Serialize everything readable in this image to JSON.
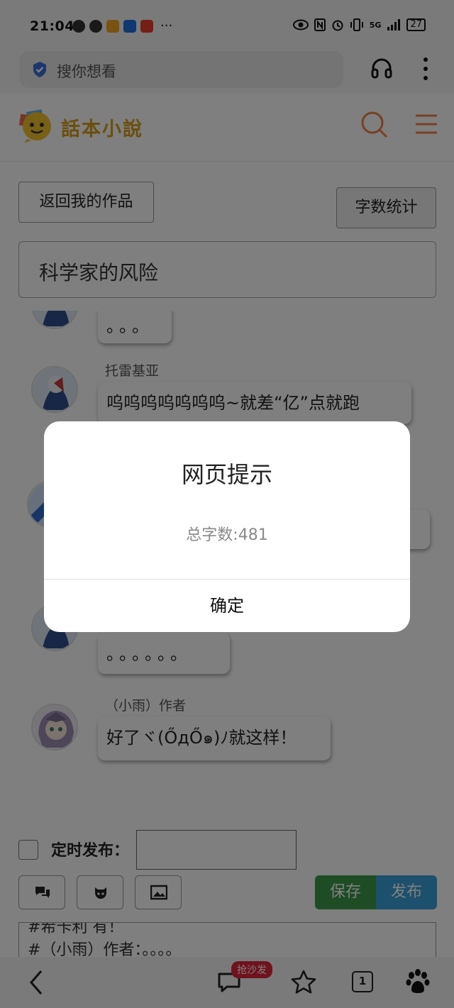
{
  "status_bar": {
    "time": "21:04",
    "network": "5G",
    "battery": "27",
    "more_indicator": "···"
  },
  "browser": {
    "search_placeholder": "搜你想看",
    "icons": [
      "shield-check-icon",
      "headset-icon",
      "kebab-menu-icon"
    ]
  },
  "site": {
    "logo_text": "話本小說",
    "icons": [
      "search-icon",
      "hamburger-menu-icon"
    ]
  },
  "editor_page": {
    "back_button": "返回我的作品",
    "word_count_button": "字数统计",
    "work_title": "科学家的风险",
    "messages": [
      {
        "sender": "",
        "text": "。。。",
        "avatar": "tolleo-avatar"
      },
      {
        "sender": "托雷基亚",
        "text": "呜呜呜呜呜呜呜~就差“亿”点就跑",
        "avatar": "tolleo-avatar"
      },
      {
        "sender": "",
        "text": "",
        "avatar": "blue-avatar"
      },
      {
        "sender": "",
        "text": "。。。。。。",
        "avatar": "tolleo-avatar"
      },
      {
        "sender": "（小雨）作者",
        "text": "好了ヾ(ŐдŐ๑)ﾉ就这样！",
        "avatar": "girl-avatar"
      }
    ],
    "schedule_label": "定时发布：",
    "schedule_value": "",
    "tool_icons": [
      "chat-bubbles-icon",
      "github-icon",
      "image-icon"
    ],
    "save_button": "保存",
    "publish_button": "发布",
    "editor_lines": [
      "#希卡利 有！",
      "#（小雨）作者：。。。。"
    ]
  },
  "bottom_nav": {
    "comment_badge": "抢沙发",
    "tab_count": "1",
    "icons": [
      "back-arrow-icon",
      "comment-icon",
      "star-icon",
      "tabs-icon",
      "baidu-paw-icon"
    ]
  },
  "dialog": {
    "title": "网页提示",
    "message": "总字数:481",
    "ok_button": "确定"
  }
}
